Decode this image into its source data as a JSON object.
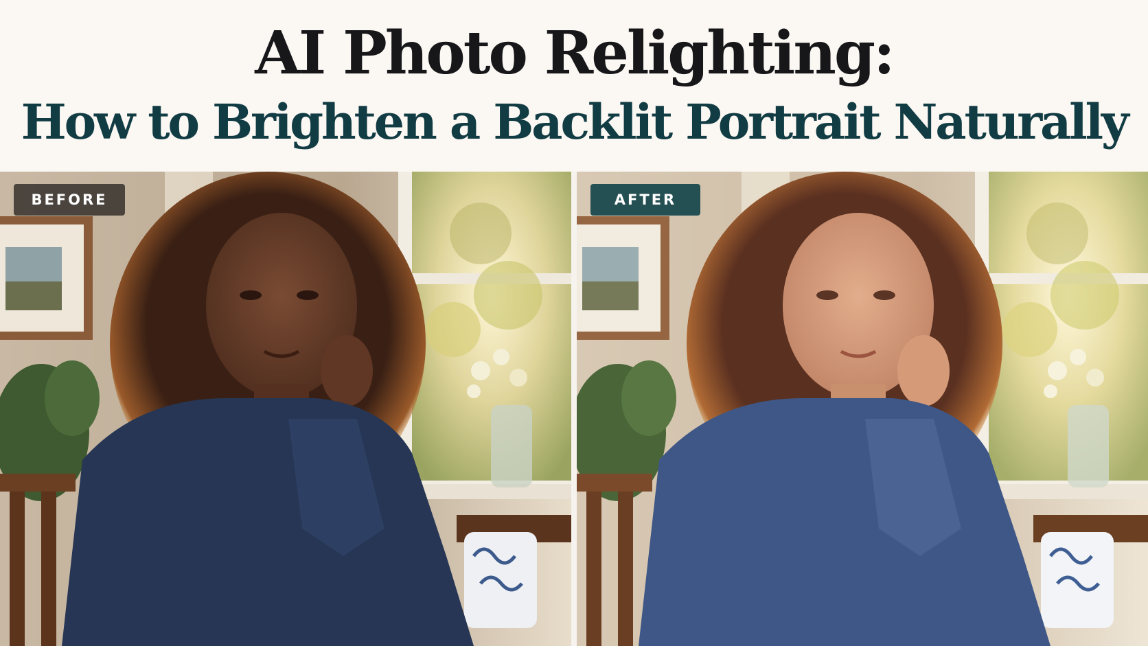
{
  "header": {
    "title_line1": "AI Photo Relighting:",
    "title_line2": "How to Brighten a Backlit Portrait Naturally"
  },
  "panels": [
    {
      "label": "BEFORE",
      "badge_color": "#3a3430"
    },
    {
      "label": "AFTER",
      "badge_color": "#244f53"
    }
  ],
  "colors": {
    "title_dark": "#17171a",
    "title_teal": "#123c44",
    "background": "#fbf8f3",
    "shirt_blue": "#3f5786"
  }
}
